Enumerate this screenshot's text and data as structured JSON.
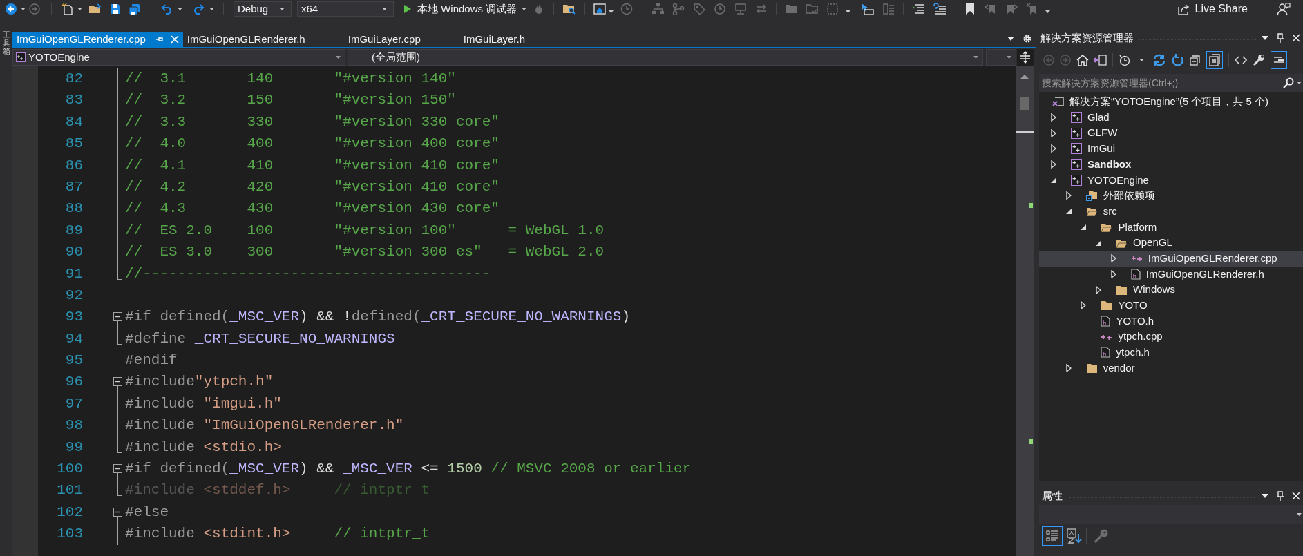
{
  "toolbar": {
    "configuration": "Debug",
    "platform": "x64",
    "debugger": "本地 Windows 调试器",
    "live_share": "Live Share"
  },
  "toolbox_tab": "工具箱",
  "tabs": [
    {
      "label": "ImGuiOpenGLRenderer.cpp",
      "selected": true
    },
    {
      "label": "ImGuiOpenGLRenderer.h",
      "selected": false
    },
    {
      "label": "ImGuiLayer.cpp",
      "selected": false
    },
    {
      "label": "ImGuiLayer.h",
      "selected": false
    }
  ],
  "navigation": {
    "project": "YOTOEngine",
    "scope": "(全局范围)"
  },
  "editor": {
    "lines": [
      {
        "number": "82",
        "kind": "fold_body",
        "inactive": false,
        "tokens": [
          {
            "kind": "comment",
            "text": "//  3.1       140       \"#version 140\""
          }
        ]
      },
      {
        "number": "83",
        "kind": "fold_body",
        "inactive": false,
        "tokens": [
          {
            "kind": "comment",
            "text": "//  3.2       150       \"#version 150\""
          }
        ]
      },
      {
        "number": "84",
        "kind": "fold_body",
        "inactive": false,
        "tokens": [
          {
            "kind": "comment",
            "text": "//  3.3       330       \"#version 330 core\""
          }
        ]
      },
      {
        "number": "85",
        "kind": "fold_body",
        "inactive": false,
        "tokens": [
          {
            "kind": "comment",
            "text": "//  4.0       400       \"#version 400 core\""
          }
        ]
      },
      {
        "number": "86",
        "kind": "fold_body",
        "inactive": false,
        "tokens": [
          {
            "kind": "comment",
            "text": "//  4.1       410       \"#version 410 core\""
          }
        ]
      },
      {
        "number": "87",
        "kind": "fold_body",
        "inactive": false,
        "tokens": [
          {
            "kind": "comment",
            "text": "//  4.2       420       \"#version 410 core\""
          }
        ]
      },
      {
        "number": "88",
        "kind": "fold_body",
        "inactive": false,
        "tokens": [
          {
            "kind": "comment",
            "text": "//  4.3       430       \"#version 430 core\""
          }
        ]
      },
      {
        "number": "89",
        "kind": "fold_body",
        "inactive": false,
        "tokens": [
          {
            "kind": "comment",
            "text": "//  ES 2.0    100       \"#version 100\"      = WebGL 1.0"
          }
        ]
      },
      {
        "number": "90",
        "kind": "fold_body",
        "inactive": false,
        "tokens": [
          {
            "kind": "comment",
            "text": "//  ES 3.0    300       \"#version 300 es\"   = WebGL 2.0"
          }
        ]
      },
      {
        "number": "91",
        "kind": "fold_end",
        "inactive": false,
        "tokens": [
          {
            "kind": "comment",
            "text": "//----------------------------------------"
          }
        ]
      },
      {
        "number": "92",
        "inactive": false
      },
      {
        "number": "93",
        "kind": "fold_start",
        "inactive": false,
        "tokens": [
          {
            "kind": "directive",
            "text": "#if defined("
          },
          {
            "kind": "macro",
            "text": "_MSC_VER"
          },
          {
            "kind": "plain",
            "text": ") && !"
          },
          {
            "kind": "directive",
            "text": "defined("
          },
          {
            "kind": "macro",
            "text": "_CRT_SECURE_NO_WARNINGS"
          },
          {
            "kind": "plain",
            "text": ")"
          }
        ]
      },
      {
        "number": "94",
        "kind": "fold_end",
        "inactive": false,
        "tokens": [
          {
            "kind": "directive",
            "text": "#define "
          },
          {
            "kind": "macro",
            "text": "_CRT_SECURE_NO_WARNINGS"
          }
        ]
      },
      {
        "number": "95",
        "inactive": false,
        "tokens": [
          {
            "kind": "directive",
            "text": "#endif"
          }
        ]
      },
      {
        "number": "96",
        "kind": "fold_start",
        "inactive": false,
        "tokens": [
          {
            "kind": "directive",
            "text": "#include"
          },
          {
            "kind": "string",
            "text": "\"ytpch.h\""
          }
        ]
      },
      {
        "number": "97",
        "kind": "fold_body",
        "inactive": false,
        "tokens": [
          {
            "kind": "directive",
            "text": "#include "
          },
          {
            "kind": "string",
            "text": "\"imgui.h\""
          }
        ]
      },
      {
        "number": "98",
        "kind": "fold_body",
        "inactive": false,
        "tokens": [
          {
            "kind": "directive",
            "text": "#include "
          },
          {
            "kind": "string",
            "text": "\"ImGuiOpenGLRenderer.h\""
          }
        ]
      },
      {
        "number": "99",
        "kind": "fold_end",
        "inactive": false,
        "tokens": [
          {
            "kind": "directive",
            "text": "#include "
          },
          {
            "kind": "string",
            "text": "<stdio.h>"
          }
        ]
      },
      {
        "number": "100",
        "kind": "fold_start",
        "inactive": false,
        "tokens": [
          {
            "kind": "directive",
            "text": "#if defined("
          },
          {
            "kind": "macro",
            "text": "_MSC_VER"
          },
          {
            "kind": "plain",
            "text": ") && "
          },
          {
            "kind": "macro",
            "text": "_MSC_VER"
          },
          {
            "kind": "plain",
            "text": " <= "
          },
          {
            "kind": "number",
            "text": "1500"
          },
          {
            "kind": "comment",
            "text": " // MSVC 2008 or earlier"
          }
        ]
      },
      {
        "number": "101",
        "kind": "fold_end",
        "inactive": true,
        "tokens": [
          {
            "kind": "directive",
            "text": "#include "
          },
          {
            "kind": "string",
            "text": "<stddef.h>"
          },
          {
            "kind": "comment",
            "text": "     // intptr_t"
          }
        ]
      },
      {
        "number": "102",
        "kind": "fold_start",
        "inactive": false,
        "tokens": [
          {
            "kind": "directive",
            "text": "#else"
          }
        ]
      },
      {
        "number": "103",
        "kind": "fold_body",
        "inactive": false,
        "tokens": [
          {
            "kind": "directive",
            "text": "#include "
          },
          {
            "kind": "string",
            "text": "<stdint.h>"
          },
          {
            "kind": "comment",
            "text": "     // intptr_t"
          }
        ]
      }
    ]
  },
  "solution_explorer": {
    "title": "解决方案资源管理器",
    "search": {
      "placeholder": "搜索解决方案资源管理器(Ctrl+;)"
    },
    "solution": {
      "label": "解决方案“YOTOEngine”(5 个项目，共 5 个)",
      "selected": false,
      "children": [
        {
          "label": "Glad",
          "kind": "project",
          "startup": false,
          "expanded": false,
          "selected": false
        },
        {
          "label": "GLFW",
          "kind": "project",
          "startup": false,
          "expanded": false,
          "selected": false
        },
        {
          "label": "ImGui",
          "kind": "project",
          "startup": false,
          "expanded": false,
          "selected": false
        },
        {
          "label": "Sandbox",
          "kind": "project",
          "startup": true,
          "expanded": false,
          "selected": false
        },
        {
          "label": "YOTOEngine",
          "kind": "project",
          "startup": false,
          "expanded": true,
          "selected": false,
          "children": [
            {
              "label": "外部依赖项",
              "kind": "references",
              "expanded": false,
              "selected": false
            },
            {
              "label": "src",
              "kind": "folder",
              "expanded": true,
              "selected": false,
              "children": [
                {
                  "label": "Platform",
                  "kind": "folder",
                  "expanded": true,
                  "selected": false,
                  "children": [
                    {
                      "label": "OpenGL",
                      "kind": "folder",
                      "expanded": true,
                      "selected": false,
                      "children": [
                        {
                          "label": "ImGuiOpenGLRenderer.cpp",
                          "kind": "cpp",
                          "expanded": false,
                          "selected": true
                        },
                        {
                          "label": "ImGuiOpenGLRenderer.h",
                          "kind": "header",
                          "expanded": false,
                          "selected": false
                        }
                      ]
                    },
                    {
                      "label": "Windows",
                      "kind": "folder",
                      "expanded": false,
                      "selected": false
                    }
                  ]
                },
                {
                  "label": "YOTO",
                  "kind": "folder",
                  "expanded": false,
                  "selected": false
                },
                {
                  "label": "YOTO.h",
                  "kind": "header",
                  "selected": false
                },
                {
                  "label": "ytpch.cpp",
                  "kind": "cpp",
                  "selected": false
                },
                {
                  "label": "ytpch.h",
                  "kind": "header",
                  "selected": false
                }
              ]
            },
            {
              "label": "vendor",
              "kind": "folder",
              "expanded": false,
              "selected": false
            }
          ]
        }
      ]
    }
  },
  "properties": {
    "title": "属性"
  }
}
